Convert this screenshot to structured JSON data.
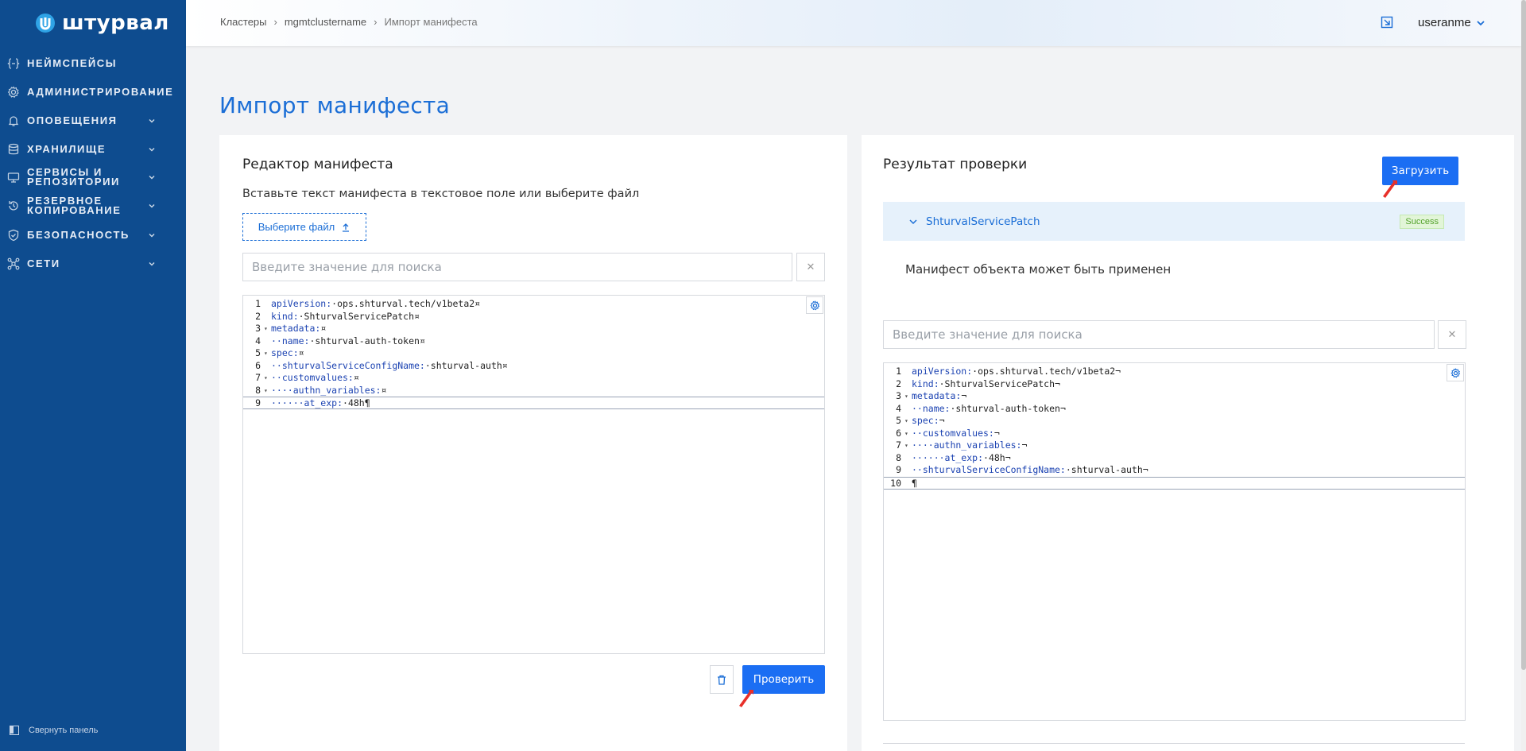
{
  "brand": {
    "name": "штурвал"
  },
  "sidebar": {
    "items": [
      {
        "label": "Неймспейсы",
        "icon": "braces-icon",
        "has_chevron": false
      },
      {
        "label": "Администрирование",
        "icon": "gear-icon",
        "has_chevron": true
      },
      {
        "label": "Оповещения",
        "icon": "bell-icon",
        "has_chevron": true
      },
      {
        "label": "Хранилище",
        "icon": "database-icon",
        "has_chevron": true
      },
      {
        "label": "Сервисы и репозитории",
        "icon": "services-icon",
        "has_chevron": true
      },
      {
        "label": "Резервное копирование",
        "icon": "backup-icon",
        "has_chevron": true
      },
      {
        "label": "Безопасность",
        "icon": "shield-icon",
        "has_chevron": true
      },
      {
        "label": "Сети",
        "icon": "network-icon",
        "has_chevron": true
      }
    ],
    "collapse_label": "Свернуть панель"
  },
  "header": {
    "breadcrumb": [
      "Кластеры",
      "mgmtclustername",
      "Импорт манифеста"
    ],
    "username": "useranme"
  },
  "page": {
    "title": "Импорт манифеста"
  },
  "editor_card": {
    "title": "Редактор манифеста",
    "hint": "Вставьте текст манифеста в текстовое поле или выберите файл",
    "file_button": "Выберите файл",
    "search_placeholder": "Введите значение для поиска",
    "check_button": "Проверить",
    "lines": [
      {
        "n": "1",
        "fold": false,
        "key": "apiVersion:",
        "val": "·ops.shturval.tech/v1beta2¤"
      },
      {
        "n": "2",
        "fold": false,
        "key": "kind:",
        "val": "·ShturvalServicePatch¤"
      },
      {
        "n": "3",
        "fold": true,
        "key": "metadata:",
        "val": "¤"
      },
      {
        "n": "4",
        "fold": false,
        "key": "··name:",
        "val": "·shturval-auth-token¤"
      },
      {
        "n": "5",
        "fold": true,
        "key": "spec:",
        "val": "¤"
      },
      {
        "n": "6",
        "fold": false,
        "key": "··shturvalServiceConfigName:",
        "val": "·shturval-auth¤"
      },
      {
        "n": "7",
        "fold": true,
        "key": "··customvalues:",
        "val": "¤"
      },
      {
        "n": "8",
        "fold": true,
        "key": "····authn_variables:",
        "val": "¤"
      },
      {
        "n": "9",
        "fold": false,
        "key": "······at_exp:",
        "val": "·48h¶"
      }
    ]
  },
  "result_card": {
    "title": "Результат проверки",
    "upload_button": "Загрузить",
    "item_name": "ShturvalServicePatch",
    "status": "Success",
    "message": "Манифест объекта может быть применен",
    "search_placeholder": "Введите значение для поиска",
    "lines": [
      {
        "n": "1",
        "fold": false,
        "key": "apiVersion:",
        "val": "·ops.shturval.tech/v1beta2¬"
      },
      {
        "n": "2",
        "fold": false,
        "key": "kind:",
        "val": "·ShturvalServicePatch¬"
      },
      {
        "n": "3",
        "fold": true,
        "key": "metadata:",
        "val": "¬"
      },
      {
        "n": "4",
        "fold": false,
        "key": "··name:",
        "val": "·shturval-auth-token¬"
      },
      {
        "n": "5",
        "fold": true,
        "key": "spec:",
        "val": "¬"
      },
      {
        "n": "6",
        "fold": true,
        "key": "··customvalues:",
        "val": "¬"
      },
      {
        "n": "7",
        "fold": true,
        "key": "····authn_variables:",
        "val": "¬"
      },
      {
        "n": "8",
        "fold": false,
        "key": "······at_exp:",
        "val": "·48h¬"
      },
      {
        "n": "9",
        "fold": false,
        "key": "··shturvalServiceConfigName:",
        "val": "·shturval-auth¬"
      },
      {
        "n": "10",
        "fold": false,
        "key": "",
        "val": "¶"
      }
    ]
  },
  "colors": {
    "sidebar": "#0e4c8f",
    "accent": "#1b6ef3",
    "success": "#52a12a"
  }
}
